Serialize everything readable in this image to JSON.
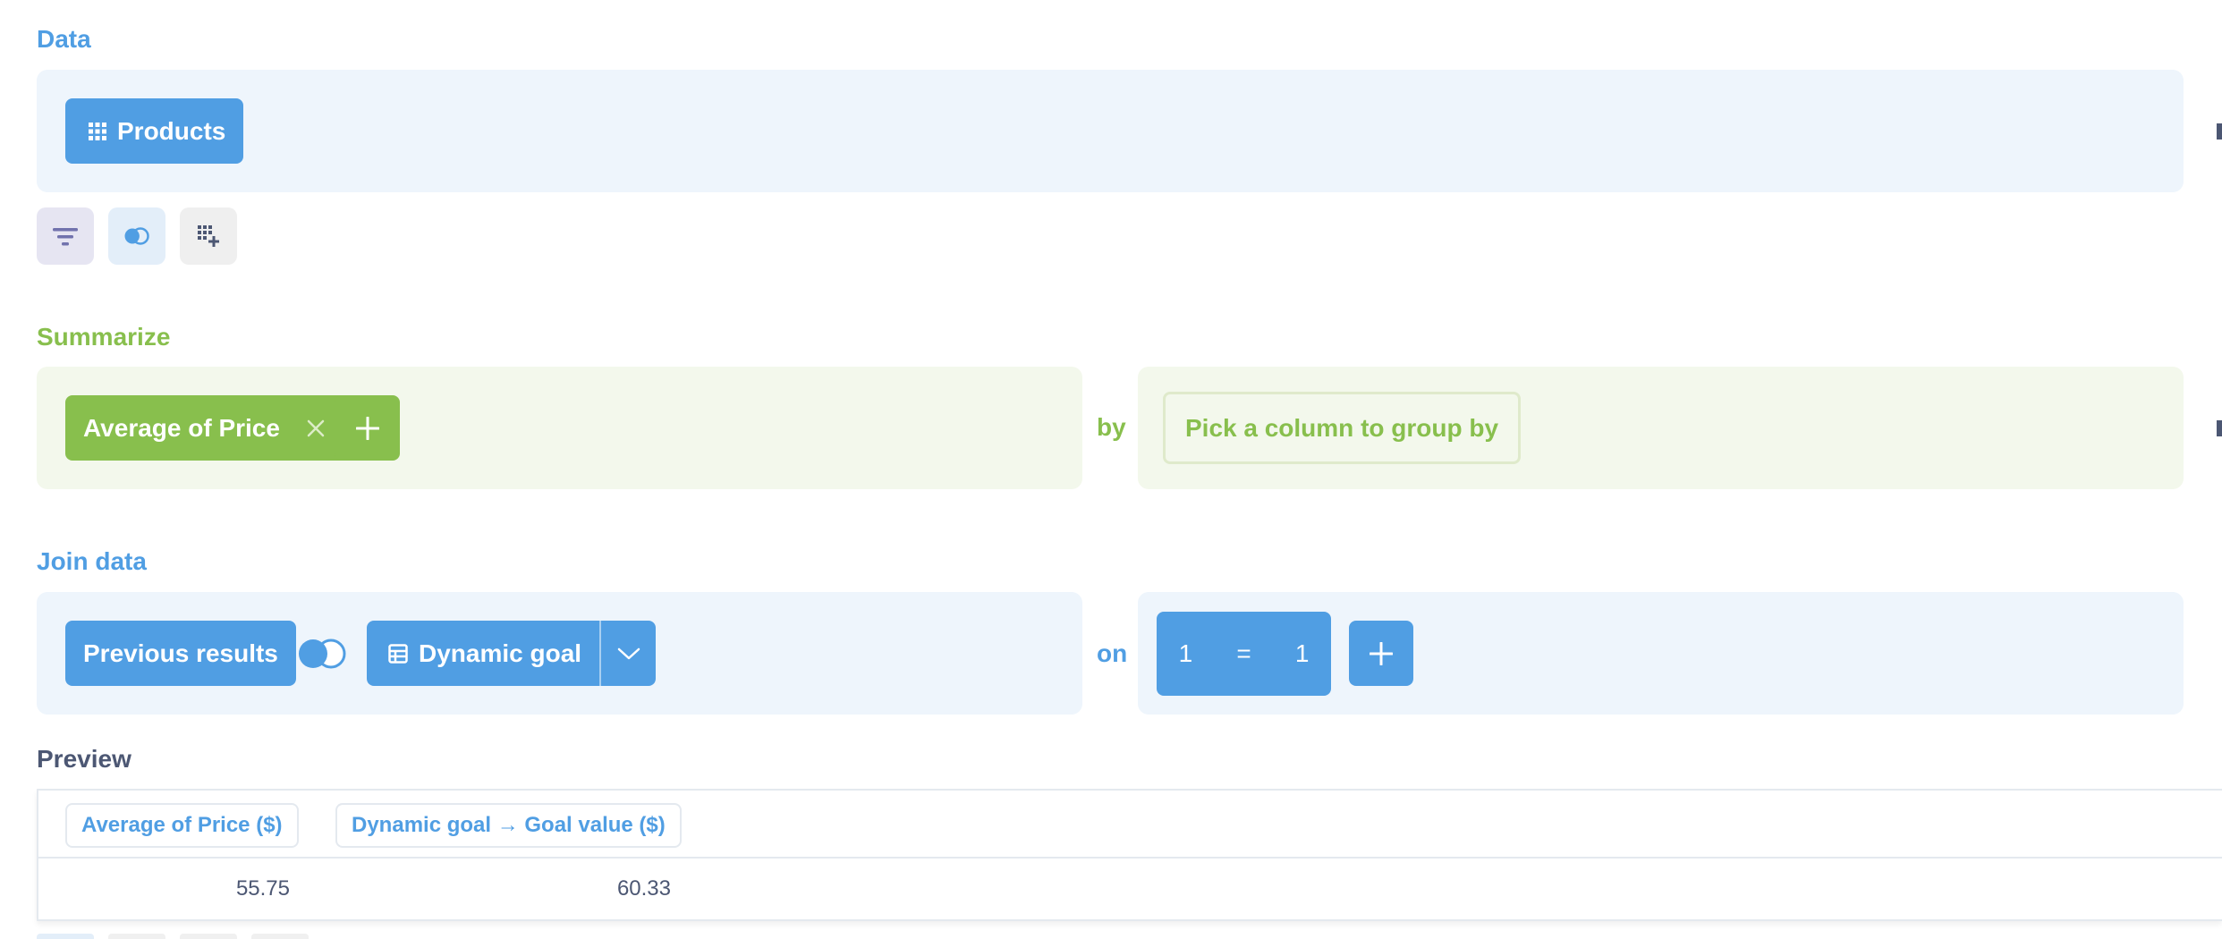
{
  "data_section": {
    "label": "Data",
    "source": {
      "label": "Products",
      "icon": "grid-icon"
    },
    "tools": [
      {
        "name": "filter",
        "icon": "filter-icon"
      },
      {
        "name": "join",
        "icon": "join-icon"
      },
      {
        "name": "custom-column",
        "icon": "add-column-icon"
      }
    ]
  },
  "summarize_section": {
    "label": "Summarize",
    "metric": {
      "label": "Average of Price",
      "remove_icon": "close-icon"
    },
    "add_icon": "plus-icon",
    "by_label": "by",
    "group_by_placeholder": "Pick a column to group by"
  },
  "join_section": {
    "label": "Join data",
    "left": "Previous results",
    "join_type_icon": "left-join-icon",
    "right": {
      "label": "Dynamic goal",
      "icon": "table-icon",
      "dropdown_icon": "chevron-down-icon"
    },
    "on_label": "on",
    "condition": {
      "lhs": "1",
      "operator": "=",
      "rhs": "1"
    },
    "add_icon": "plus-icon"
  },
  "preview": {
    "label": "Preview",
    "columns": [
      "Average of Price ($)",
      "Dynamic goal → Goal value ($)"
    ],
    "rows": [
      [
        "55.75",
        "60.33"
      ]
    ]
  },
  "colors": {
    "blue": "#509ee3",
    "green": "#88bf4d",
    "blue_panel": "#eef5fc",
    "green_panel": "#f3f8ec",
    "text": "#4c5773",
    "border": "#e4e9ef"
  }
}
